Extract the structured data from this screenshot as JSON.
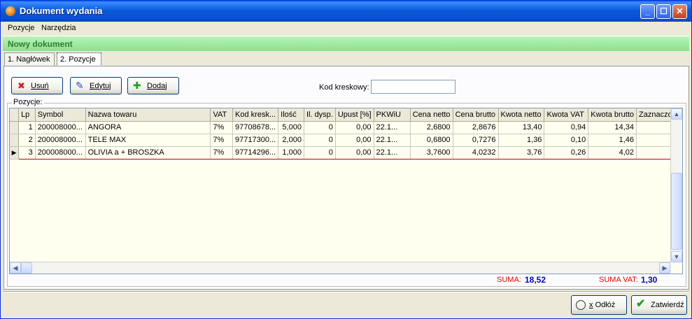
{
  "window": {
    "title": "Dokument wydania"
  },
  "menu": [
    {
      "label": "Pozycje"
    },
    {
      "label": "Narzędzia"
    }
  ],
  "banner": {
    "text": "Nowy dokument"
  },
  "tabs": [
    {
      "label": "1. Nagłówek"
    },
    {
      "label": "2. Pozycje"
    }
  ],
  "toolbar": {
    "delete_label": "Usuń",
    "edit_label": "Edytuj",
    "add_label": "Dodaj"
  },
  "barcode": {
    "label": "Kod kreskowy:",
    "value": ""
  },
  "group": {
    "label": "Pozycje:"
  },
  "grid": {
    "columns": [
      "Lp",
      "Symbol",
      "Nazwa towaru",
      "VAT",
      "Kod kresk...",
      "Ilość",
      "Il. dysp.",
      "Upust [%]",
      "PKWiU",
      "Cena netto",
      "Cena brutto",
      "Kwota netto",
      "Kwota VAT",
      "Kwota brutto",
      "Zaznaczo..."
    ],
    "rows": [
      [
        "1",
        "200008000...",
        "ANGORA",
        "7%",
        "97708678...",
        "5,000",
        "0",
        "0,00",
        "22.1...",
        "2,6800",
        "2,8676",
        "13,40",
        "0,94",
        "14,34",
        ""
      ],
      [
        "2",
        "200008000...",
        "TELE MAX",
        "7%",
        "97717300...",
        "2,000",
        "0",
        "0,00",
        "22.1...",
        "0,6800",
        "0,7276",
        "1,36",
        "0,10",
        "1,46",
        ""
      ],
      [
        "3",
        "200008000...",
        "OLIVIA a + BROSZKA",
        "7%",
        "97714296...",
        "1,000",
        "0",
        "0,00",
        "22.1...",
        "3,7600",
        "4,0232",
        "3,76",
        "0,26",
        "4,02",
        ""
      ]
    ],
    "selected_row": 3
  },
  "summary": {
    "sum_label": "SUMA:",
    "sum_value": "18,52",
    "vat_label": "SUMA VAT:",
    "vat_value": "1,30"
  },
  "footer": {
    "cancel_label": "Odłóż",
    "cancel_prefix": "x",
    "confirm_label": "Zatwierdź"
  },
  "colors": {
    "title_bar": "#0a5fe8",
    "banner": "#a6eca6",
    "grid_bg": "#fffff0",
    "sum_label": "#e00000",
    "sum_value": "#0000c0"
  }
}
